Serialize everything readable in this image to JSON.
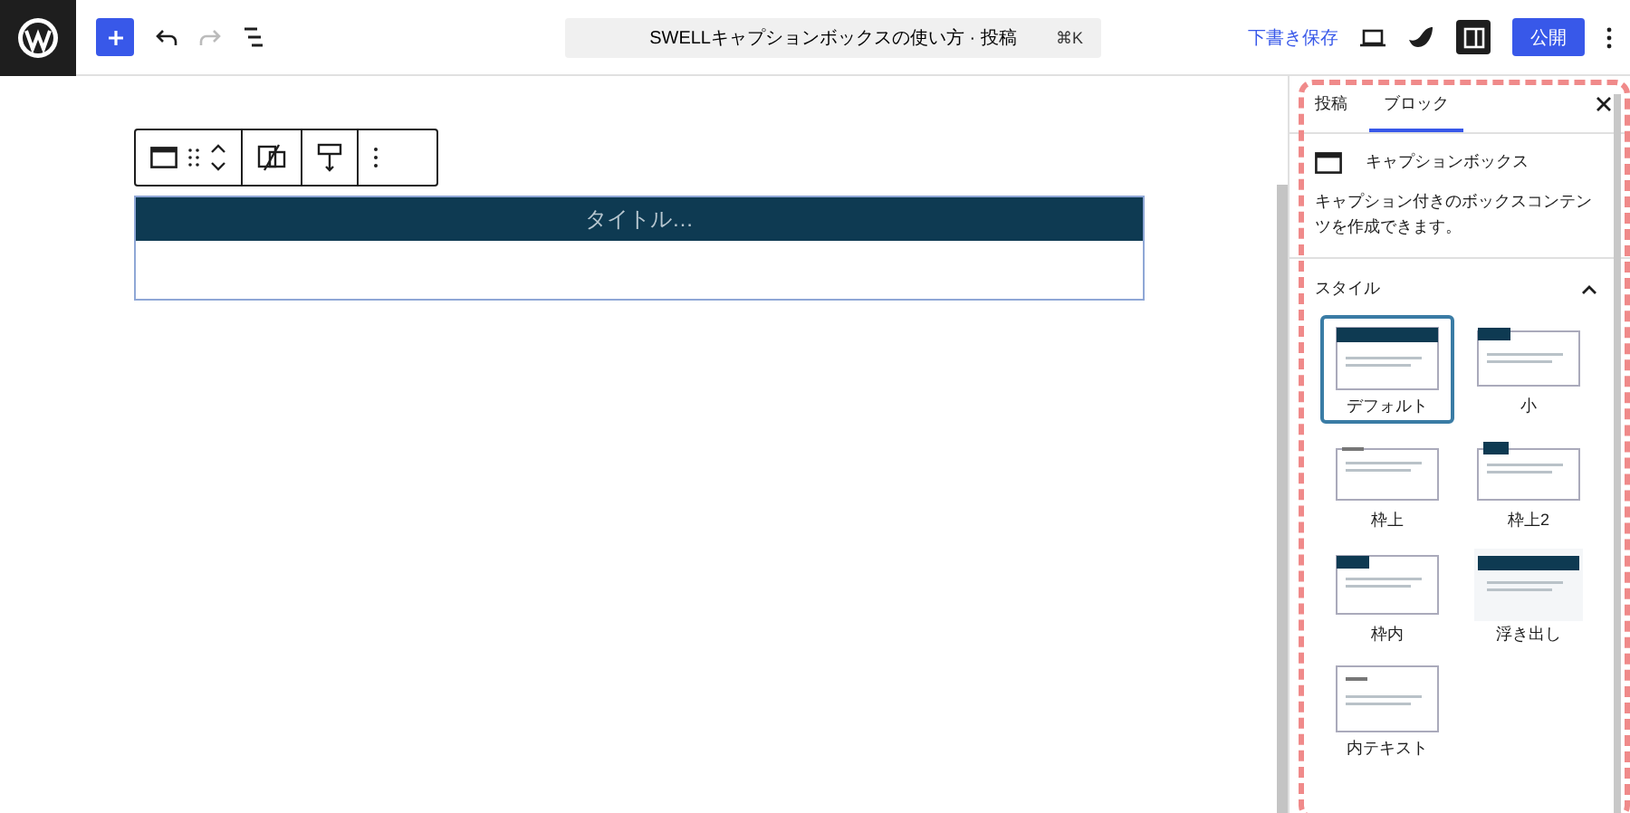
{
  "header": {
    "title": "SWELLキャプションボックスの使い方 · 投稿",
    "shortcut": "⌘K",
    "save_draft": "下書き保存",
    "publish": "公開",
    "settings_selected": true
  },
  "canvas": {
    "caption_placeholder": "タイトル…"
  },
  "sidebar": {
    "tabs": [
      {
        "label": "投稿",
        "selected": false
      },
      {
        "label": "ブロック",
        "selected": true
      }
    ],
    "block_name": "キャプションボックス",
    "block_description": "キャプション付きのボックスコンテンツを作成できます。",
    "styles_heading": "スタイル",
    "styles_expanded": true,
    "styles": [
      {
        "label": "デフォルト",
        "kind": "default",
        "selected": true
      },
      {
        "label": "小",
        "kind": "small",
        "selected": false
      },
      {
        "label": "枠上",
        "kind": "ontop",
        "selected": false
      },
      {
        "label": "枠上2",
        "kind": "ontop2",
        "selected": false
      },
      {
        "label": "枠内",
        "kind": "inner",
        "selected": false
      },
      {
        "label": "浮き出し",
        "kind": "float",
        "selected": false
      },
      {
        "label": "内テキスト",
        "kind": "text",
        "selected": false
      }
    ]
  }
}
